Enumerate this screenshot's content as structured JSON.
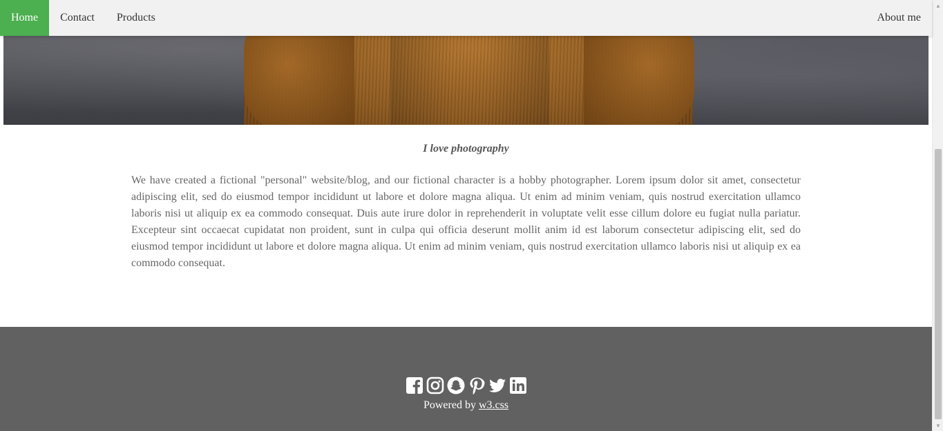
{
  "nav": {
    "home": "Home",
    "contact": "Contact",
    "products": "Products",
    "about": "About me",
    "active_color": "#4caf50"
  },
  "content": {
    "tagline": "I love photography",
    "paragraph": "We have created a fictional \"personal\" website/blog, and our fictional character is a hobby photographer. Lorem ipsum dolor sit amet, consectetur adipiscing elit, sed do eiusmod tempor incididunt ut labore et dolore magna aliqua. Ut enim ad minim veniam, quis nostrud exercitation ullamco laboris nisi ut aliquip ex ea commodo consequat. Duis aute irure dolor in reprehenderit in voluptate velit esse cillum dolore eu fugiat nulla pariatur. Excepteur sint occaecat cupidatat non proident, sunt in culpa qui officia deserunt mollit anim id est laborum consectetur adipiscing elit, sed do eiusmod tempor incididunt ut labore et dolore magna aliqua. Ut enim ad minim veniam, quis nostrud exercitation ullamco laboris nisi ut aliquip ex ea commodo consequat."
  },
  "footer": {
    "powered_prefix": "Powered by ",
    "powered_link": "w3.css",
    "background": "#616161",
    "social_icons": [
      "facebook-icon",
      "instagram-icon",
      "snapchat-icon",
      "pinterest-icon",
      "twitter-icon",
      "linkedin-icon"
    ]
  }
}
